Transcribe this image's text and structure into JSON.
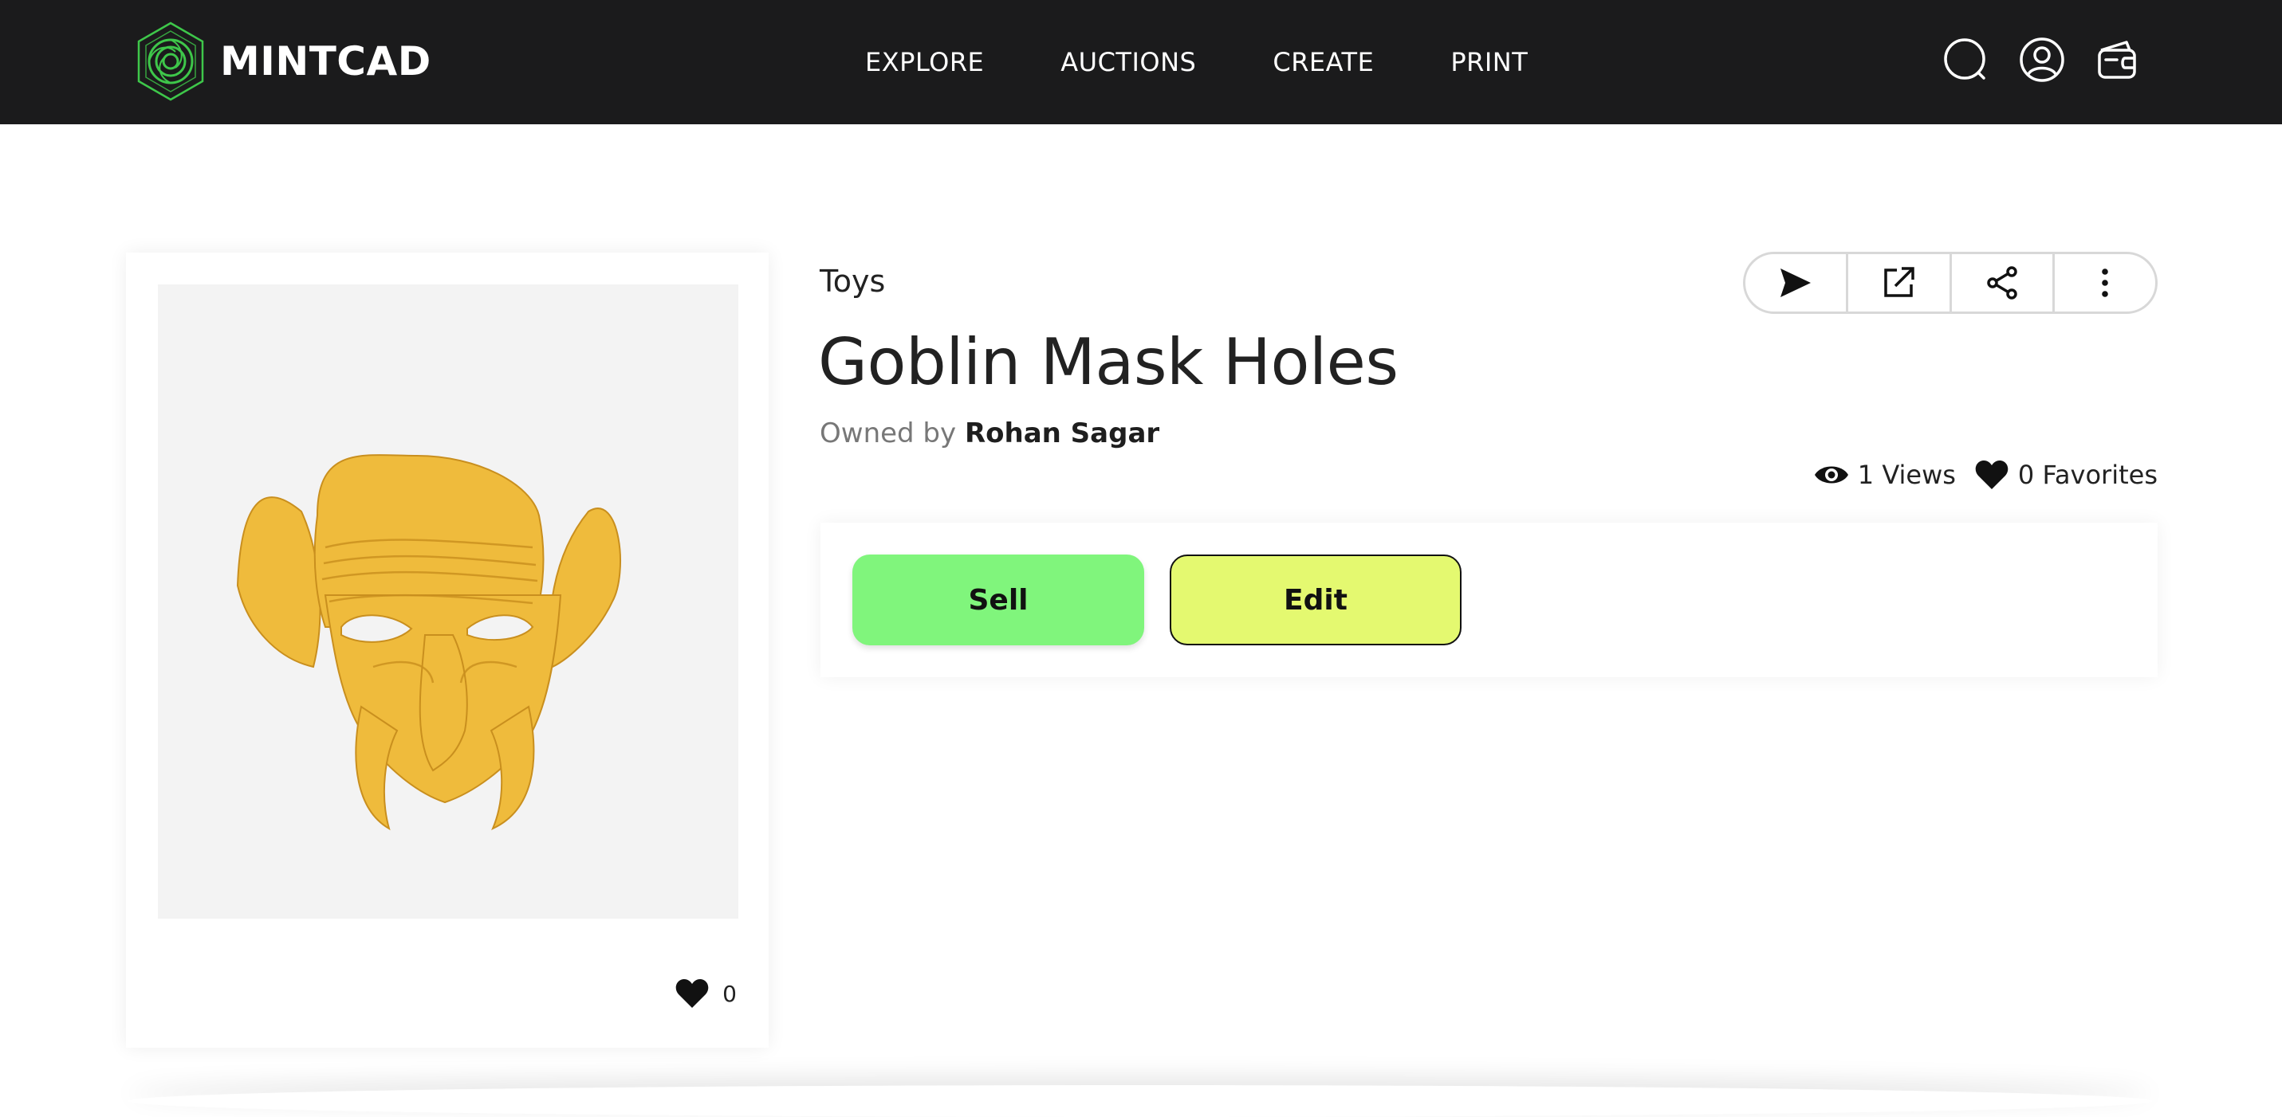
{
  "header": {
    "brand": "MINTCAD",
    "nav": [
      "EXPLORE",
      "AUCTIONS",
      "CREATE",
      "PRINT"
    ],
    "icons": [
      "search-icon",
      "user-icon",
      "wallet-icon"
    ]
  },
  "item": {
    "category": "Toys",
    "title": "Goblin Mask Holes",
    "owner_label": "Owned by",
    "owner_name": "Rohan Sagar",
    "views": "1 Views",
    "favorites": "0 Favorites",
    "card_favorites": "0",
    "model_color": "#efbb3c"
  },
  "toolbar": {
    "icons": [
      "send-icon",
      "open-external-icon",
      "share-icon",
      "more-icon"
    ]
  },
  "buttons": {
    "sell": "Sell",
    "edit": "Edit"
  },
  "colors": {
    "header_bg": "#1b1b1c",
    "sell_bg": "#80f57c",
    "edit_bg": "#e4f970",
    "logo_green": "#3ec74a"
  }
}
